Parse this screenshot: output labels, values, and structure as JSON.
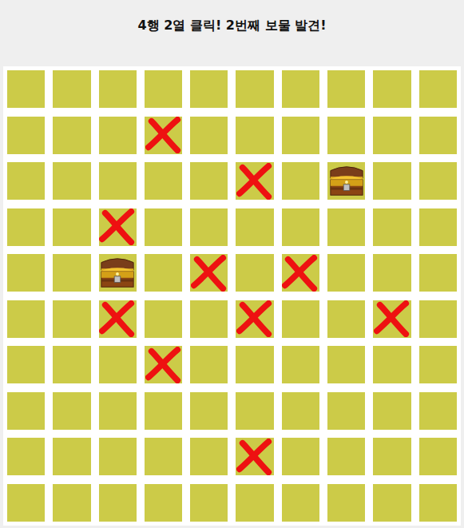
{
  "title": "4행 2열 클릭! 2번째 보물 발견!",
  "board": {
    "rows": [
      {
        "cells": [
          {
            "kind": "empty"
          },
          {
            "kind": "empty"
          },
          {
            "kind": "empty"
          },
          {
            "kind": "empty"
          },
          {
            "kind": "empty"
          },
          {
            "kind": "empty"
          },
          {
            "kind": "empty"
          },
          {
            "kind": "empty"
          },
          {
            "kind": "empty"
          },
          {
            "kind": "empty"
          }
        ]
      },
      {
        "cells": [
          {
            "kind": "empty"
          },
          {
            "kind": "empty"
          },
          {
            "kind": "empty"
          },
          {
            "kind": "miss"
          },
          {
            "kind": "empty"
          },
          {
            "kind": "empty"
          },
          {
            "kind": "empty"
          },
          {
            "kind": "empty"
          },
          {
            "kind": "empty"
          },
          {
            "kind": "empty"
          }
        ]
      },
      {
        "cells": [
          {
            "kind": "empty"
          },
          {
            "kind": "empty"
          },
          {
            "kind": "empty"
          },
          {
            "kind": "empty"
          },
          {
            "kind": "empty"
          },
          {
            "kind": "miss"
          },
          {
            "kind": "empty"
          },
          {
            "kind": "treasure"
          },
          {
            "kind": "empty"
          },
          {
            "kind": "empty"
          }
        ]
      },
      {
        "cells": [
          {
            "kind": "empty"
          },
          {
            "kind": "empty"
          },
          {
            "kind": "miss"
          },
          {
            "kind": "empty"
          },
          {
            "kind": "empty"
          },
          {
            "kind": "empty"
          },
          {
            "kind": "empty"
          },
          {
            "kind": "empty"
          },
          {
            "kind": "empty"
          },
          {
            "kind": "empty"
          }
        ]
      },
      {
        "cells": [
          {
            "kind": "empty"
          },
          {
            "kind": "empty"
          },
          {
            "kind": "treasure"
          },
          {
            "kind": "empty"
          },
          {
            "kind": "miss"
          },
          {
            "kind": "empty"
          },
          {
            "kind": "miss"
          },
          {
            "kind": "empty"
          },
          {
            "kind": "empty"
          },
          {
            "kind": "empty"
          }
        ]
      },
      {
        "cells": [
          {
            "kind": "empty"
          },
          {
            "kind": "empty"
          },
          {
            "kind": "miss"
          },
          {
            "kind": "empty"
          },
          {
            "kind": "empty"
          },
          {
            "kind": "miss"
          },
          {
            "kind": "empty"
          },
          {
            "kind": "empty"
          },
          {
            "kind": "miss"
          },
          {
            "kind": "empty"
          }
        ]
      },
      {
        "cells": [
          {
            "kind": "empty"
          },
          {
            "kind": "empty"
          },
          {
            "kind": "empty"
          },
          {
            "kind": "miss"
          },
          {
            "kind": "empty"
          },
          {
            "kind": "empty"
          },
          {
            "kind": "empty"
          },
          {
            "kind": "empty"
          },
          {
            "kind": "empty"
          },
          {
            "kind": "empty"
          }
        ]
      },
      {
        "cells": [
          {
            "kind": "empty"
          },
          {
            "kind": "empty"
          },
          {
            "kind": "empty"
          },
          {
            "kind": "empty"
          },
          {
            "kind": "empty"
          },
          {
            "kind": "empty"
          },
          {
            "kind": "empty"
          },
          {
            "kind": "empty"
          },
          {
            "kind": "empty"
          },
          {
            "kind": "empty"
          }
        ]
      },
      {
        "cells": [
          {
            "kind": "empty"
          },
          {
            "kind": "empty"
          },
          {
            "kind": "empty"
          },
          {
            "kind": "empty"
          },
          {
            "kind": "empty"
          },
          {
            "kind": "miss"
          },
          {
            "kind": "empty"
          },
          {
            "kind": "empty"
          },
          {
            "kind": "empty"
          },
          {
            "kind": "empty"
          }
        ]
      },
      {
        "cells": [
          {
            "kind": "empty"
          },
          {
            "kind": "empty"
          },
          {
            "kind": "empty"
          },
          {
            "kind": "empty"
          },
          {
            "kind": "empty"
          },
          {
            "kind": "empty"
          },
          {
            "kind": "empty"
          },
          {
            "kind": "empty"
          },
          {
            "kind": "empty"
          },
          {
            "kind": "empty"
          }
        ]
      }
    ]
  }
}
